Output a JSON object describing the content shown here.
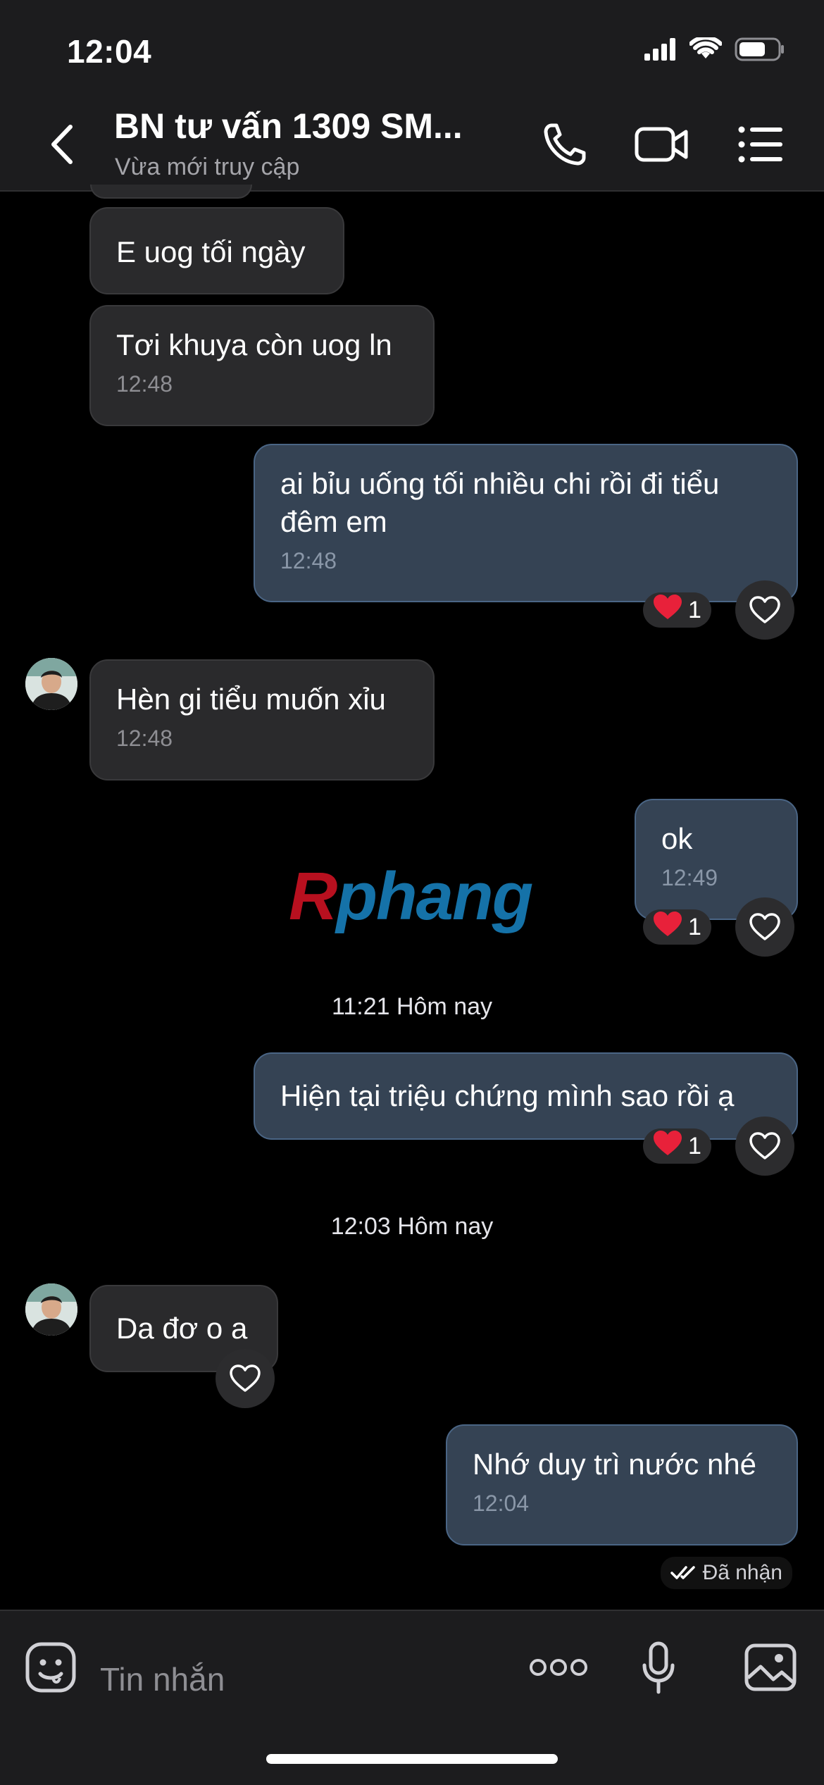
{
  "status_bar": {
    "time": "12:04"
  },
  "header": {
    "title": "BN tư vấn 1309 SM...",
    "subtitle": "Vừa mới truy cập"
  },
  "messages": [
    {
      "dir": "in",
      "text": "E uog tối ngày",
      "time": ""
    },
    {
      "dir": "in",
      "text": "Tơi khuya còn uog ln",
      "time": "12:48"
    },
    {
      "dir": "out",
      "text": "ai bỉu uống tối nhiều chi rồi đi tiểu đêm em",
      "time": "12:48",
      "reaction_count": "1"
    },
    {
      "dir": "in",
      "text": "Hèn gi tiểu muốn xỉu",
      "time": "12:48"
    },
    {
      "dir": "out",
      "text": "ok",
      "time": "12:49",
      "reaction_count": "1"
    },
    {
      "dir": "out",
      "text": "Hiện tại triệu chứng mình sao rồi ạ",
      "time": "",
      "reaction_count": "1"
    },
    {
      "dir": "in",
      "text": "Da đơ o a",
      "time": ""
    },
    {
      "dir": "out",
      "text": "Nhớ duy trì nước nhé",
      "time": "12:04"
    }
  ],
  "separators": [
    "11:21 Hôm nay",
    "12:03 Hôm nay"
  ],
  "watermark": {
    "first": "R",
    "rest": "phang"
  },
  "delivery_status": "Đã nhận",
  "input": {
    "placeholder": "Tin nhắn"
  },
  "colors": {
    "outgoing_bubble": "#354354",
    "incoming_bubble": "#2a2a2c",
    "reaction_heart": "#e8213a"
  }
}
